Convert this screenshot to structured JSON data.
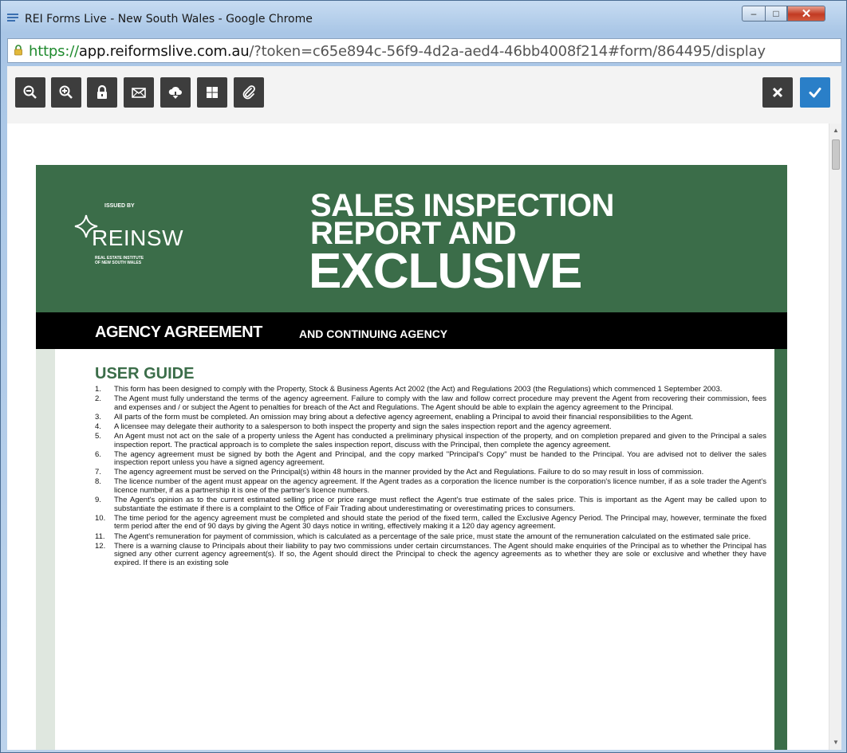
{
  "window": {
    "title": "REI Forms Live - New South Wales - Google Chrome",
    "minimize": "–",
    "maximize": "□",
    "close": "✕"
  },
  "address": {
    "scheme": "https://",
    "host": "app.reiformslive.com.au",
    "path": "/?token=c65e894c-56f9-4d2a-aed4-46bb4008f214#form/864495/display"
  },
  "toolbar": {
    "buttons": [
      "zoom-out",
      "zoom-in",
      "lock",
      "email",
      "download",
      "grid",
      "attach"
    ],
    "right_buttons": [
      "close",
      "confirm"
    ],
    "confirm_color": "#2a7fc8"
  },
  "form": {
    "issued_by": "ISSUED BY",
    "logo_name": "REINSW",
    "logo_sub_line1": "REAL ESTATE INSTITUTE",
    "logo_sub_line2": "OF NEW SOUTH WALES",
    "heading_line1": "SALES INSPECTION",
    "heading_line2": "REPORT AND",
    "heading_line3": "EXCLUSIVE",
    "agency_main": "AGENCY AGREEMENT",
    "agency_sub": "AND CONTINUING AGENCY",
    "brand_color": "#3b6d49",
    "guide_title": "USER GUIDE",
    "guide_items": [
      {
        "num": "1.",
        "text": "This form has been designed to comply with the Property, Stock & Business Agents Act 2002 (the Act) and Regulations 2003 (the Regulations) which commenced 1 September 2003."
      },
      {
        "num": "2.",
        "text": "The Agent must fully understand the terms of the agency agreement. Failure to comply with the law and follow correct procedure may prevent the Agent from recovering their commission, fees and expenses and / or subject the Agent to penalties for breach of the Act and Regulations. The Agent should be able to explain the agency agreement to the Principal."
      },
      {
        "num": "3.",
        "text": "All parts of the form must be completed. An omission may bring about a defective agency agreement, enabling a Principal to avoid their financial responsibilities to the Agent."
      },
      {
        "num": "4.",
        "text": "A licensee may delegate their authority to a salesperson to both inspect the property and sign the sales inspection report and the agency agreement."
      },
      {
        "num": "5.",
        "text": "An Agent must not act on the sale of a property unless the Agent has conducted a preliminary physical inspection of the property, and on completion prepared and given to the Principal a sales inspection report. The practical approach is to complete the sales inspection report, discuss with the Principal, then complete the agency agreement."
      },
      {
        "num": "6.",
        "text": "The agency agreement must be signed by both the Agent and Principal, and the copy marked \"Principal's Copy\" must be handed to the Principal. You are advised not to deliver the sales inspection report unless you have a signed agency agreement."
      },
      {
        "num": "7.",
        "text": "The agency agreement must be served on the Principal(s) within 48 hours in the manner provided by the Act and Regulations. Failure to do so may result in loss of commission."
      },
      {
        "num": "8.",
        "text": "The licence number of the agent must appear on the agency agreement. If the Agent trades as a corporation the licence number is the corporation's licence number, if as a sole trader the Agent's licence number, if as a partnership it is one of the partner's licence numbers."
      },
      {
        "num": "9.",
        "text": "The Agent's opinion as to the current estimated selling price or price range must reflect the Agent's true estimate of the sales price. This is important as the Agent may be called upon to substantiate the estimate if there is a complaint to the Office of Fair Trading about underestimating or overestimating prices to consumers."
      },
      {
        "num": "10.",
        "text": "The time period for the agency agreement must be completed and should state the period of the fixed term, called the Exclusive Agency Period. The Principal may, however, terminate the fixed term period after the end of 90 days by giving the Agent 30 days notice in writing, effectively making it a 120 day agency agreement."
      },
      {
        "num": "11.",
        "text": "The Agent's remuneration for payment of commission, which is calculated as a percentage of the sale price, must state the amount of the remuneration calculated on the estimated sale price."
      },
      {
        "num": "12.",
        "text": "There is a warning clause to Principals about their liability to pay two commissions under certain circumstances. The Agent should make enquiries of the Principal as to whether the Principal has signed any other current agency agreement(s). If so, the Agent should direct the Principal to check the agency agreements as to whether they are sole or exclusive and whether they have expired. If there is an existing sole"
      }
    ]
  },
  "scroll": {
    "up": "▲",
    "down": "▼"
  }
}
